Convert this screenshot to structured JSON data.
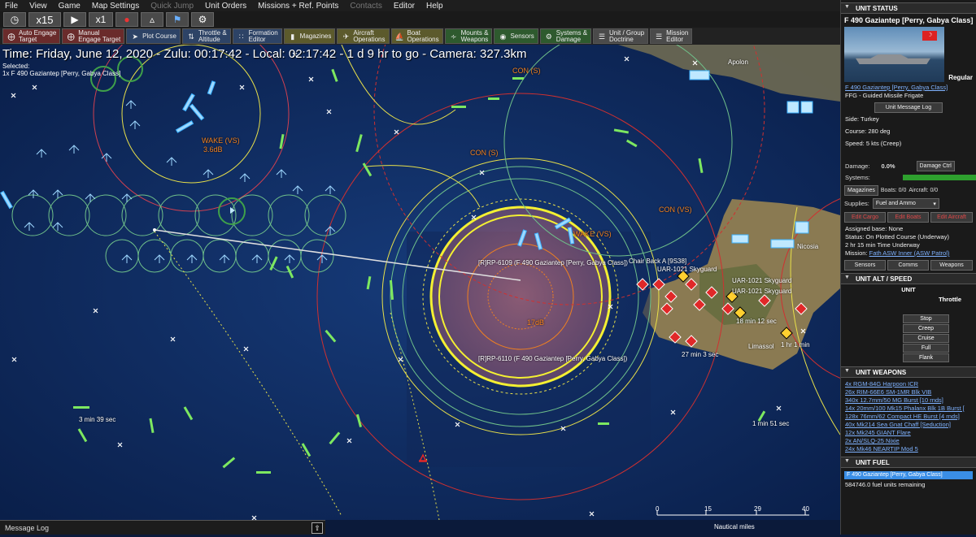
{
  "menu": [
    "File",
    "View",
    "Game",
    "Map Settings",
    "Quick Jump",
    "Unit Orders",
    "Missions + Ref. Points",
    "Contacts",
    "Editor",
    "Help"
  ],
  "menu_disabled": [
    "Quick Jump",
    "Contacts"
  ],
  "toolbar1": {
    "compression": "x15",
    "speed": "x1"
  },
  "toolbar2": [
    {
      "label": "Auto Engage\nTarget",
      "icon": "crosshair-icon",
      "color": "red"
    },
    {
      "label": "Manual\nEngage Target",
      "icon": "target-icon",
      "color": "red"
    },
    {
      "label": "Plot Course",
      "icon": "course-icon",
      "color": "blue"
    },
    {
      "label": "Throttle &\nAltitude",
      "icon": "throttle-icon",
      "color": "blue"
    },
    {
      "label": "Formation\nEditor",
      "icon": "formation-icon",
      "color": "blue"
    },
    {
      "label": "Magazines",
      "icon": "magazine-icon",
      "color": "olive"
    },
    {
      "label": "Aircraft\nOperations",
      "icon": "aircraft-icon",
      "color": "olive"
    },
    {
      "label": "Boat\nOperations",
      "icon": "boat-icon",
      "color": "olive"
    },
    {
      "label": "Mounts &\nWeapons",
      "icon": "weapons-icon",
      "color": "green"
    },
    {
      "label": "Sensors",
      "icon": "sensor-icon",
      "color": "green"
    },
    {
      "label": "Systems &\nDamage",
      "icon": "gear-icon",
      "color": "green"
    },
    {
      "label": "Unit / Group\nDoctrine",
      "icon": "doctrine-icon",
      "color": "grey"
    },
    {
      "label": "Mission\nEditor",
      "icon": "mission-icon",
      "color": "grey"
    }
  ],
  "status_line": "Time: Friday, June 12, 2020 - Zulu: 00:17:42 - Local: 02:17:42 - 1 d 9 hr to go - Camera: 327.3km",
  "selected": {
    "title": "Selected:",
    "unit": "1x F 490 Gaziantep [Perry, Gabya Class]"
  },
  "map_labels": {
    "con_s_1": "CON (S)",
    "con_s_2": "CON (S)",
    "con_vs": "CON (VS)",
    "wake_vs_1": "WAKE (VS)",
    "db_36": "3.6dB",
    "wake_vs_2": "WAKE (VS)",
    "db_17": "17dB",
    "rp6109": "[R]RP-6109 (F 490 Gaziantep [Perry, Gabya Class])",
    "rp6110": "[R]RP-6110 (F 490 Gaziantep [Perry, Gabya Class])",
    "chairback": "Chair Back A [9S38]",
    "uar1": "UAR-1021 Skyguard",
    "uar2": "UAR-1021 Skyguard",
    "uar3": "UAR-1021 Skyguard",
    "apolon": "Apolon",
    "limassol": "Limassol",
    "nicosia": "Nicosia",
    "min39": "3 min 39 sec",
    "min51": "1 min 51 sec",
    "min27": "27 min 3 sec",
    "min12": "18 min 12 sec",
    "min1": "1 hr 1 min"
  },
  "scale": {
    "ticks": [
      "0",
      "15",
      "29",
      "40"
    ],
    "unit": "Nautical miles"
  },
  "message_log": "Message Log",
  "unit_status": {
    "header": "UNIT STATUS",
    "name": "F 490 Gaziantep [Perry, Gabya Class]",
    "proficiency": "Regular",
    "link_name": "F 490 Gaziantep [Perry, Gabya Class]",
    "type": "FFG - Guided Missile Frigate",
    "msglog_btn": "Unit Message Log",
    "side": "Side: Turkey",
    "course": "Course: 280 deg",
    "speed": "Speed: 5 kts (Creep)",
    "damage_label": "Damage:",
    "damage_value": "0.0%",
    "damage_btn": "Damage Ctrl",
    "systems_label": "Systems:",
    "magazines_btn": "Magazines",
    "boats": "Boats: 0/0",
    "aircraft": "Aircraft: 0/0",
    "supplies_label": "Supplies:",
    "supplies_value": "Fuel and Ammo",
    "edit_cargo": "Edit Cargo",
    "edit_boats": "Edit Boats",
    "edit_aircraft": "Edit Aircraft",
    "base": "Assigned base: None",
    "status": "Status: On Plotted Course (Underway)",
    "time": "2 hr 15 min Time Underway",
    "mission_label": "Mission:",
    "mission": "Fath ASW Inner (ASW Patrol)",
    "sensors_btn": "Sensors",
    "comms_btn": "Comms",
    "weapons_btn": "Weapons"
  },
  "alt_speed": {
    "header": "UNIT ALT / SPEED",
    "unit_label": "UNIT",
    "throttle_label": "Throttle",
    "buttons": [
      "Stop",
      "Creep",
      "Cruise",
      "Full",
      "Flank"
    ]
  },
  "weapons": {
    "header": "UNIT WEAPONS",
    "items": [
      "4x RGM-84G Harpoon ICR",
      "26x RIM-66E6 SM-1MR Blk VIB",
      "340x 12.7mm/50 MG Burst [10 rnds]",
      "14x 20mm/100 Mk15 Phalanx Blk 1B Burst [",
      "128x 76mm/62 Compact HE Burst [4 rnds]",
      "40x Mk214 Sea Gnat Chaff [Seduction]",
      "12x Mk245 GIANT Flare",
      "2x AN/SLQ-25 Nixie",
      "24x Mk46 NEARTIP Mod 5"
    ]
  },
  "fuel": {
    "header": "UNIT FUEL",
    "unit": "F 490 Gaziantep [Perry, Gabya Class]",
    "remaining": "584746.0 fuel units remaining"
  },
  "colors": {
    "sea": "#0f2a5c",
    "land": "#8a7a52",
    "ring_yellow": "#f4f032",
    "ring_red": "#d03030",
    "ring_green": "#6fc08a",
    "friendly_blue": "#5fd0ff",
    "hostile_red": "#e02828",
    "link": "#7fb2ff"
  }
}
